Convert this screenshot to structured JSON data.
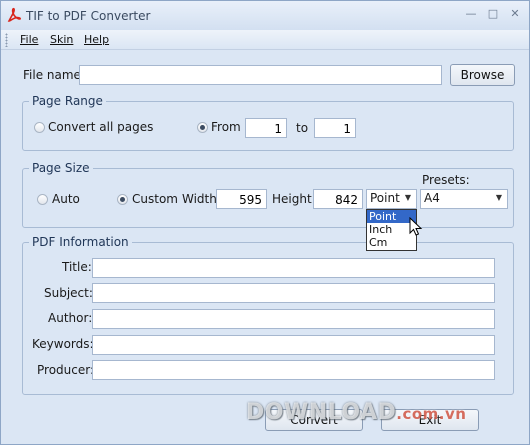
{
  "window": {
    "title": "TIF to PDF Converter"
  },
  "menu": {
    "file": "File",
    "skin": "Skin",
    "help": "Help"
  },
  "file_name": {
    "label": "File name:",
    "value": "",
    "browse_label": "Browse"
  },
  "page_range": {
    "title": "Page Range",
    "convert_all_label": "Convert all pages",
    "convert_all_selected": false,
    "from_label": "From",
    "from_selected": true,
    "from_value": "1",
    "to_label": "to",
    "to_value": "1"
  },
  "page_size": {
    "title": "Page Size",
    "auto_label": "Auto",
    "auto_selected": false,
    "custom_label": "Custom",
    "custom_selected": true,
    "width_label": "Width",
    "width_value": "595",
    "height_label": "Height",
    "height_value": "842",
    "unit_selected": "Point",
    "unit_options": [
      "Point",
      "Inch",
      "Cm"
    ],
    "presets_label": "Presets:",
    "preset_selected": "A4"
  },
  "pdf_info": {
    "title": "PDF Information",
    "fields": [
      {
        "label": "Title:",
        "value": ""
      },
      {
        "label": "Subject:",
        "value": ""
      },
      {
        "label": "Author:",
        "value": ""
      },
      {
        "label": "Keywords:",
        "value": ""
      },
      {
        "label": "Producer:",
        "value": ""
      }
    ]
  },
  "actions": {
    "convert_label": "Convert",
    "exit_label": "Exit"
  },
  "watermark": {
    "main": "DOWNLOAD",
    "suffix": ".com.vn"
  },
  "colors": {
    "window_bg": "#dbe6f4",
    "group_title": "#1f3556",
    "selection": "#3368c8",
    "app_icon": "#d9261c"
  },
  "icons": {
    "app": "pdf-app-icon",
    "minimize": "minimize-icon",
    "maximize": "maximize-icon",
    "close": "close-icon",
    "cursor": "mouse-cursor-icon"
  }
}
